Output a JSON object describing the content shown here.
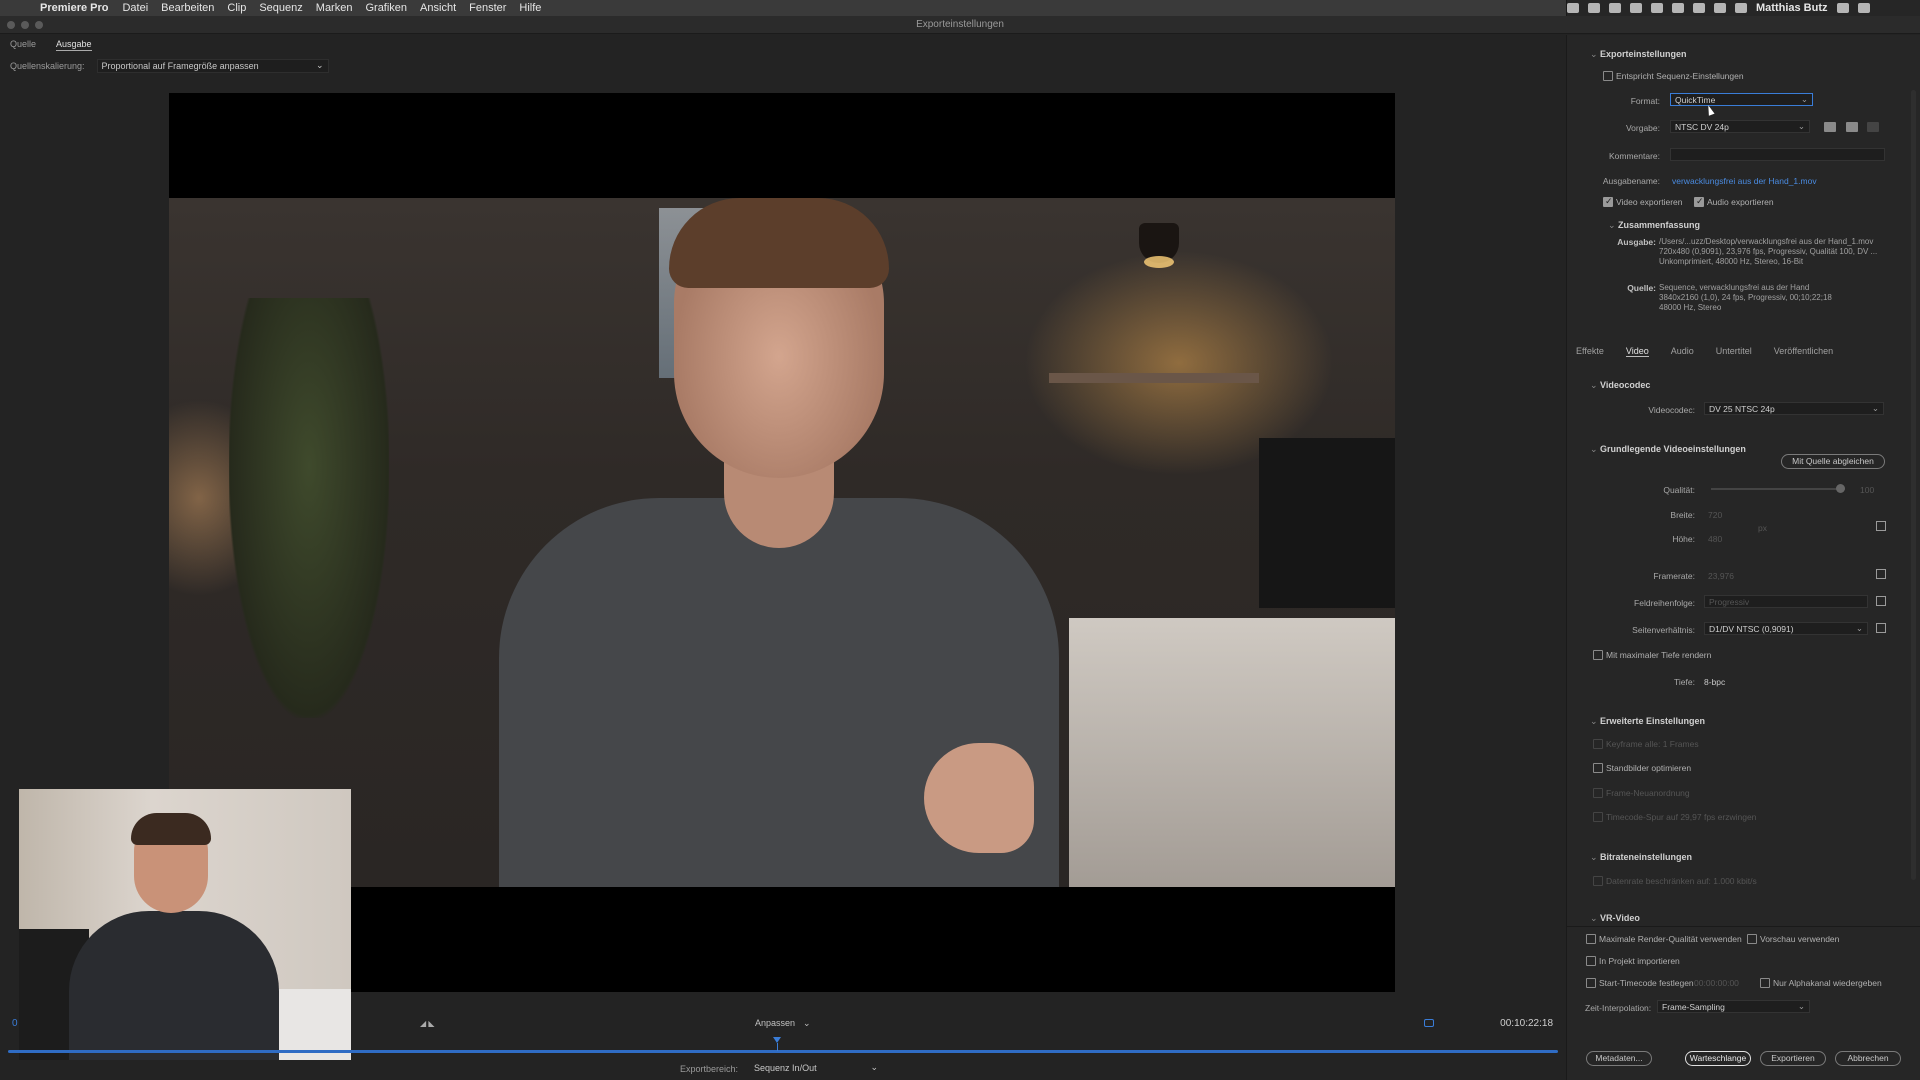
{
  "menubar": {
    "app": "Premiere Pro",
    "items": [
      "Datei",
      "Bearbeiten",
      "Clip",
      "Sequenz",
      "Marken",
      "Grafiken",
      "Ansicht",
      "Fenster",
      "Hilfe"
    ],
    "user": "Matthias Butz"
  },
  "window": {
    "title": "Exporteinstellungen"
  },
  "source_tabs": [
    "Quelle",
    "Ausgabe"
  ],
  "source_scaling": {
    "label": "Quellenskalierung:",
    "value": "Proportional auf Framegröße anpassen"
  },
  "timeline": {
    "fit": "Anpassen",
    "timecode": "00:10:22:18",
    "range_label": "Exportbereich:",
    "range_value": "Sequenz In/Out"
  },
  "export_settings": {
    "header": "Exporteinstellungen",
    "match_sequence": "Entspricht Sequenz-Einstellungen",
    "format_label": "Format:",
    "format_value": "QuickTime",
    "preset_label": "Vorgabe:",
    "preset_value": "NTSC DV 24p",
    "comments_label": "Kommentare:",
    "output_name_label": "Ausgabename:",
    "output_name_value": "verwacklungsfrei aus der Hand_1.mov",
    "export_video": "Video exportieren",
    "export_audio": "Audio exportieren",
    "summary_header": "Zusammenfassung",
    "output_label": "Ausgabe:",
    "output_lines": [
      "/Users/...uzz/Desktop/verwacklungsfrei aus der Hand_1.mov",
      "720x480 (0,9091), 23,976 fps, Progressiv, Qualität 100, DV ...",
      "Unkomprimiert, 48000 Hz, Stereo, 16-Bit"
    ],
    "source_label": "Quelle:",
    "source_lines": [
      "Sequence, verwacklungsfrei aus der Hand",
      "3840x2160 (1,0), 24 fps, Progressiv, 00;10;22;18",
      "48000 Hz, Stereo"
    ]
  },
  "panel_tabs": [
    "Effekte",
    "Video",
    "Audio",
    "Untertitel",
    "Veröffentlichen"
  ],
  "video_codec": {
    "header": "Videocodec",
    "label": "Videocodec:",
    "value": "DV 25 NTSC 24p"
  },
  "basic_video": {
    "header": "Grundlegende Videoeinstellungen",
    "match_button": "Mit Quelle abgleichen",
    "quality_label": "Qualität:",
    "quality_value": "100",
    "width_label": "Breite:",
    "width_value": "720",
    "height_label": "Höhe:",
    "height_value": "480",
    "pixel_unit": "px",
    "framerate_label": "Framerate:",
    "framerate_value": "23,976",
    "field_order_label": "Feldreihenfolge:",
    "field_order_value": "Progressiv",
    "aspect_label": "Seitenverhältnis:",
    "aspect_value": "D1/DV NTSC (0,9091)",
    "max_depth": "Mit maximaler Tiefe rendern",
    "depth_label": "Tiefe:",
    "depth_value": "8-bpc"
  },
  "advanced": {
    "header": "Erweiterte Einstellungen",
    "keyframe": "Keyframe alle: 1 Frames",
    "optimize_stills": "Standbilder optimieren",
    "frame_reorder": "Frame-Neuanordnung",
    "timecode_field": "Timecode-Spur auf 29,97 fps erzwingen"
  },
  "bitrate": {
    "header": "Bitrateneinstellungen",
    "limit": "Datenrate beschränken auf: 1.000 kbit/s"
  },
  "vr": {
    "header": "VR-Video"
  },
  "bottom": {
    "max_render": "Maximale Render-Qualität verwenden",
    "use_preview": "Vorschau verwenden",
    "import_project": "In Projekt importieren",
    "start_timecode": "Start-Timecode festlegen",
    "start_timecode_value": "00:00:00:00",
    "alpha_only": "Nur Alphakanal wiedergeben",
    "interp_label": "Zeit-Interpolation:",
    "interp_value": "Frame-Sampling",
    "metadata": "Metadaten...",
    "queue": "Warteschlange",
    "export": "Exportieren",
    "cancel": "Abbrechen"
  },
  "colors": {
    "accent": "#3a7dd8",
    "panel": "#262626",
    "background": "#232323"
  }
}
